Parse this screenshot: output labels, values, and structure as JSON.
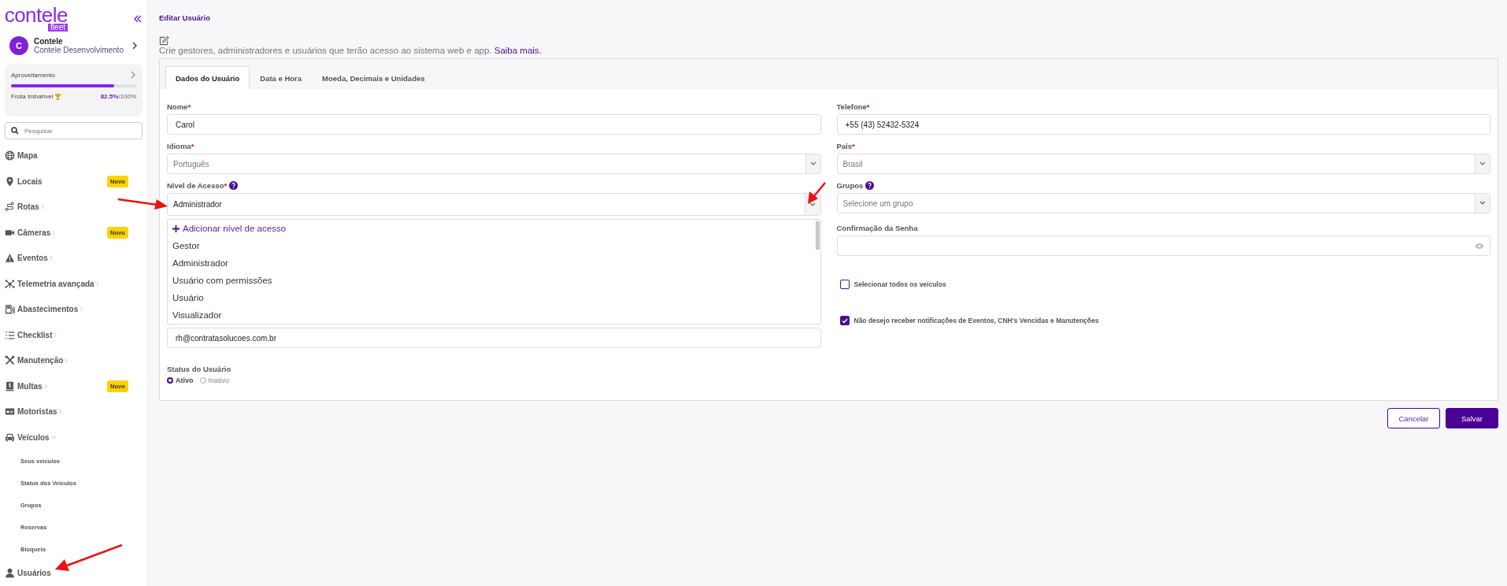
{
  "sidebar": {
    "logo": {
      "word": "contele",
      "sub": "fleet"
    },
    "profile": {
      "initial": "C",
      "name": "Contele",
      "subtitle": "Contele Desenvolvimento"
    },
    "score": {
      "title": "Aproveitamento",
      "level": 0.825,
      "caption": "Frota Imbatível",
      "value": "82.5%",
      "total": "/100%"
    },
    "search": {
      "placeholder": "Pesquisar"
    },
    "nav": [
      {
        "label": "Mapa",
        "kind": "link"
      },
      {
        "label": "Locais",
        "badge": "Novo",
        "kind": "link"
      },
      {
        "label": "Rotas",
        "kind": "group",
        "expanded": false
      },
      {
        "label": "Câmeras",
        "badge": "Novo",
        "kind": "group",
        "expanded": false
      },
      {
        "label": "Eventos",
        "kind": "group",
        "expanded": false
      },
      {
        "label": "Telemetria avançada",
        "kind": "group",
        "expanded": false
      },
      {
        "label": "Abastecimentos",
        "kind": "group",
        "expanded": false
      },
      {
        "label": "Checklist",
        "kind": "group",
        "expanded": false
      },
      {
        "label": "Manutenção",
        "kind": "group",
        "expanded": false
      },
      {
        "label": "Multas",
        "badge": "Novo",
        "kind": "group",
        "expanded": false
      },
      {
        "label": "Motoristas",
        "kind": "group",
        "expanded": false
      },
      {
        "label": "Veículos",
        "kind": "group",
        "expanded": true,
        "children": [
          "Seus veículos",
          "Status dos Veículos",
          "Grupos",
          "Reservas",
          "Bloqueio"
        ]
      },
      {
        "label": "Usuários",
        "kind": "link"
      }
    ]
  },
  "page": {
    "title": "Editar Usuário",
    "description": "Crie gestores, administradores e usuários que terão acesso ao sistema web e app.",
    "link": "Saiba mais."
  },
  "tabs": [
    {
      "label": "Dados do Usuário",
      "selected": true
    },
    {
      "label": "Data e Hora",
      "selected": false
    },
    {
      "label": "Moeda, Decimais e Unidades",
      "selected": false
    }
  ],
  "form": {
    "left": [
      {
        "kind": "text",
        "label": "Nome",
        "required_mark": "*",
        "value": "Carol"
      },
      {
        "kind": "select",
        "label": "Idioma",
        "required_mark": "*",
        "value": "Português",
        "disabled": true
      },
      {
        "kind": "select",
        "label": "Nível de Acesso",
        "required_mark": "*",
        "help": true,
        "value": "Administrador",
        "disabled": false,
        "open": true
      },
      {
        "kind": "menu",
        "add_label": "Adicionar nível de acesso",
        "options": [
          "Gestor",
          "Administrador",
          "Usuário com permissões",
          "Usuário",
          "Visualizador"
        ]
      },
      {
        "kind": "text",
        "value": "rh@contratasolucoes.com.br"
      },
      {
        "kind": "radios",
        "label": "Status do Usuário",
        "options": [
          {
            "label": "Ativo",
            "selected": true
          },
          {
            "label": "Inativo",
            "selected": false
          }
        ]
      }
    ],
    "right": [
      {
        "kind": "text",
        "label": "Telefone",
        "required_mark": "*",
        "value": "+55 (43) 52432-5324"
      },
      {
        "kind": "select",
        "label": "País",
        "required_mark": "*",
        "value": "Brasil",
        "disabled": true
      },
      {
        "kind": "select",
        "label": "Grupos",
        "help": true,
        "placeholder": "Selecione um grupo"
      },
      {
        "kind": "password",
        "label": "Confirmação da Senha"
      },
      {
        "kind": "checkbox",
        "label": "Selecionar todos os veículos",
        "checked": false
      },
      {
        "kind": "checkbox",
        "label": "Não desejo receber notificações de Eventos, CNH's Vencidas e Manutenções",
        "checked": true
      }
    ]
  },
  "buttons": [
    {
      "label": "Cancelar",
      "kind": "secondary"
    },
    {
      "label": "Salvar",
      "kind": "primary"
    }
  ]
}
